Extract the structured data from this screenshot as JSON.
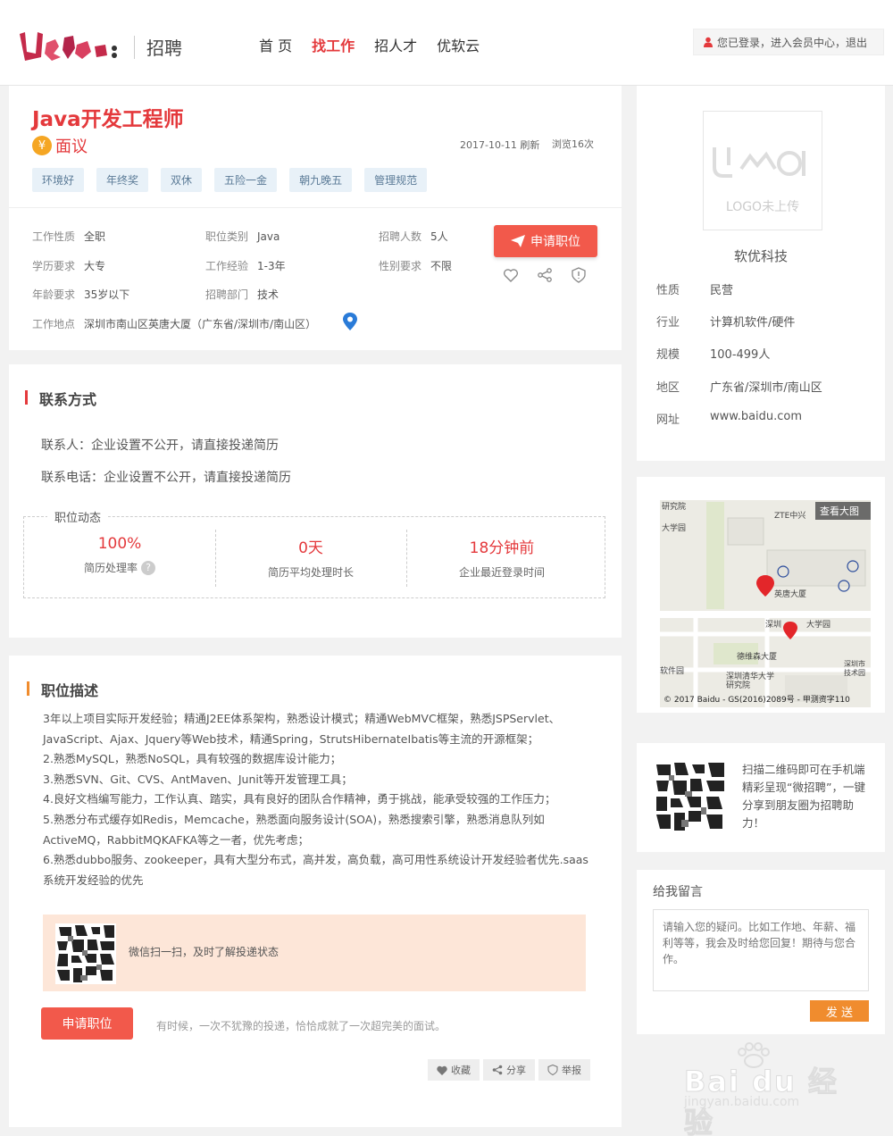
{
  "header": {
    "logo_text": "招聘",
    "nav": [
      "首 页",
      "找工作",
      "招人才",
      "优软云"
    ],
    "user_status": "您已登录，进入会员中心，退出"
  },
  "job": {
    "title": "Java开发工程师",
    "salary_icon": "¥",
    "salary": "面议",
    "date": "2017-10-11 刷新",
    "views": "浏览16次",
    "tags": [
      "环境好",
      "年终奖",
      "双休",
      "五险一金",
      "朝九晚五",
      "管理规范"
    ],
    "fields": [
      {
        "label": "工作性质",
        "value": "全职"
      },
      {
        "label": "职位类别",
        "value": "Java"
      },
      {
        "label": "招聘人数",
        "value": "5人"
      },
      {
        "label": "学历要求",
        "value": "大专"
      },
      {
        "label": "工作经验",
        "value": "1-3年"
      },
      {
        "label": "性别要求",
        "value": "不限"
      },
      {
        "label": "年龄要求",
        "value": "35岁以下"
      },
      {
        "label": "招聘部门",
        "value": "技术"
      }
    ],
    "location_label": "工作地点",
    "location": "深圳市南山区英唐大厦（广东省/深圳市/南山区）",
    "apply_label": "申请职位"
  },
  "contact": {
    "title": "联系方式",
    "person": "联系人：企业设置不公开，请直接投递简历",
    "phone": "联系电话：企业设置不公开，请直接投递简历",
    "dynamic_label": "职位动态",
    "stats": [
      {
        "value": "100%",
        "label": "简历处理率"
      },
      {
        "value": "0天",
        "label": "简历平均处理时长"
      },
      {
        "value": "18分钟前",
        "label": "企业最近登录时间"
      }
    ]
  },
  "description": {
    "title": "职位描述",
    "text": "3年以上项目实际开发经验；精通J2EE体系架构，熟悉设计模式；精通WebMVC框架，熟悉JSPServlet、JavaScript、Ajax、Jquery等Web技术，精通Spring，StrutsHibernateIbatis等主流的开源框架；\n2.熟悉MySQL，熟悉NoSQL，具有较强的数据库设计能力；\n3.熟悉SVN、Git、CVS、AntMaven、Junit等开发管理工具；\n4.良好文档编写能力，工作认真、踏实，具有良好的团队合作精神，勇于挑战，能承受较强的工作压力；\n5.熟悉分布式缓存如Redis，Memcache，熟悉面向服务设计(SOA)，熟悉搜索引擎，熟悉消息队列如ActiveMQ，RabbitMQKAFKA等之一者，优先考虑；\n6.熟悉dubbo服务、zookeeper，具有大型分布式，高并发，高负载，高可用性系统设计开发经验者优先.saas系统开发经验的优先",
    "wechat_text": "微信扫一扫，及时了解投递状态",
    "apply_label": "申请职位",
    "tip": "有时候，一次不犹豫的投递，恰恰成就了一次超完美的面试。",
    "actions": [
      "收藏",
      "分享",
      "举报"
    ]
  },
  "company": {
    "logo_placeholder": "LOGO未上传",
    "name": "软优科技",
    "rows": [
      {
        "k": "性质",
        "v": "民营"
      },
      {
        "k": "行业",
        "v": "计算机软件/硬件"
      },
      {
        "k": "规模",
        "v": "100-499人"
      },
      {
        "k": "地区",
        "v": "广东省/深圳市/南山区"
      },
      {
        "k": "网址",
        "v": "www.baidu.com"
      }
    ]
  },
  "map": {
    "view_large": "查看大图",
    "labels": [
      "研究院",
      "大学园",
      "ZTE中兴",
      "英唐大厦",
      "深圳",
      "大学园",
      "德维森大厦",
      "深圳市",
      "技术园",
      "软件园",
      "深圳清华大学",
      "研究院"
    ],
    "copyright": "© 2017 Baidu - GS(2016)2089号 - 甲测资字110"
  },
  "qr_promo": "扫描二维码即可在手机端精彩呈现“微招聘”，一键分享到朋友圈为招聘助力！",
  "message": {
    "title": "给我留言",
    "placeholder": "请输入您的疑问。比如工作地、年薪、福利等等，我会及时给您回复！期待与您合作。",
    "send": "发 送"
  },
  "watermark": {
    "text": "Bai du 经验",
    "sub": "jingyan.baidu.com"
  }
}
